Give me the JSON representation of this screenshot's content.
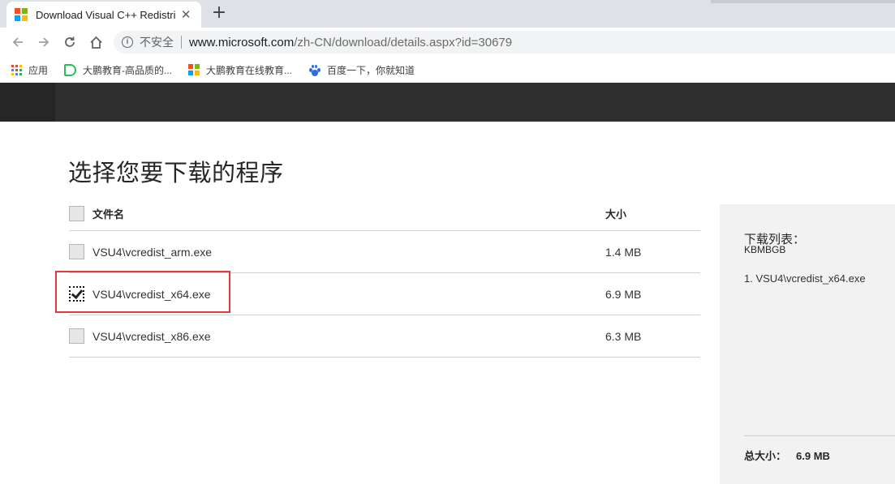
{
  "browser": {
    "tab_title": "Download Visual C++ Redistri",
    "tab_close": "✕",
    "new_tab": "+",
    "security_label": "不安全",
    "url_host": "www.microsoft.com",
    "url_path": "/zh-CN/download/details.aspx?id=30679",
    "bookmarks": [
      {
        "label": "应用",
        "icon": "apps-grid-icon"
      },
      {
        "label": "大鹏教育-高品质的...",
        "icon": "d-logo-icon"
      },
      {
        "label": "大鹏教育在线教育...",
        "icon": "colorful-squares-icon"
      },
      {
        "label": "百度一下，你就知道",
        "icon": "baidu-paw-icon"
      }
    ]
  },
  "page": {
    "title": "选择您要下载的程序",
    "table": {
      "col_name": "文件名",
      "col_size": "大小",
      "rows": [
        {
          "name": "VSU4\\vcredist_arm.exe",
          "size": "1.4 MB",
          "checked": false
        },
        {
          "name": "VSU4\\vcredist_x64.exe",
          "size": "6.9 MB",
          "checked": true
        },
        {
          "name": "VSU4\\vcredist_x86.exe",
          "size": "6.3 MB",
          "checked": false
        }
      ]
    },
    "side_panel": {
      "heading": "下载列表：",
      "sub": "KBMBGB",
      "items": [
        "1. VSU4\\vcredist_x64.exe"
      ],
      "total_label": "总大小：",
      "total_value": "6.9 MB"
    }
  },
  "colors": {
    "header_bg": "#2f2f2f",
    "highlight": "#e0393e",
    "panel_bg": "#f2f2f2"
  }
}
